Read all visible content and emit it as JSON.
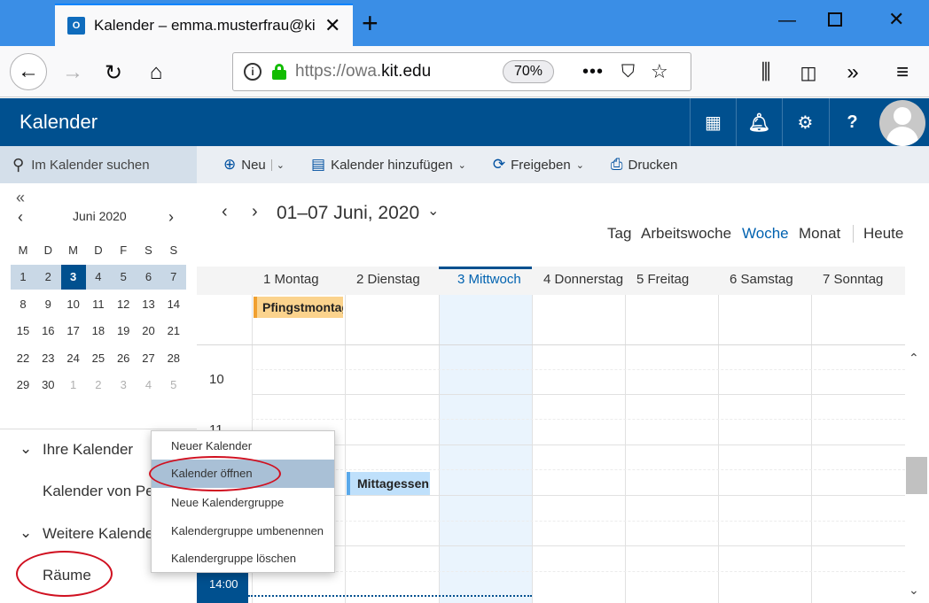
{
  "browser": {
    "tab_title": "Kalender – emma.musterfrau@kit.edu",
    "tab_favicon": "outlook-icon",
    "url_prefix": "https://owa.",
    "url_domain": "kit.edu",
    "zoom": "70%"
  },
  "app": {
    "title": "Kalender"
  },
  "search": {
    "placeholder": "Im Kalender suchen"
  },
  "toolbar": {
    "new_label": "Neu",
    "add_calendar_label": "Kalender hinzufügen",
    "share_label": "Freigeben",
    "print_label": "Drucken"
  },
  "mini_calendar": {
    "collapse": "«",
    "month_title": "Juni 2020",
    "weekday_headers": [
      "M",
      "D",
      "M",
      "D",
      "F",
      "S",
      "S"
    ],
    "weeks": [
      [
        "1",
        "2",
        "3",
        "4",
        "5",
        "6",
        "7"
      ],
      [
        "8",
        "9",
        "10",
        "11",
        "12",
        "13",
        "14"
      ],
      [
        "15",
        "16",
        "17",
        "18",
        "19",
        "20",
        "21"
      ],
      [
        "22",
        "23",
        "24",
        "25",
        "26",
        "27",
        "28"
      ],
      [
        "29",
        "30",
        "1",
        "2",
        "3",
        "4",
        "5"
      ]
    ],
    "today": "3"
  },
  "left_nav": {
    "your_calendars": "Ihre Kalender",
    "calendar_of": "Kalender von Pe",
    "other_calendars": "Weitere Kalende",
    "rooms": "Räume"
  },
  "calendar": {
    "date_range": "01–07 Juni, 2020",
    "views": [
      "Tag",
      "Arbeitswoche",
      "Woche",
      "Monat"
    ],
    "active_view": "Woche",
    "today_button": "Heute",
    "days": [
      {
        "num": "1",
        "name": "Montag"
      },
      {
        "num": "2",
        "name": "Dienstag"
      },
      {
        "num": "3",
        "name": "Mittwoch"
      },
      {
        "num": "4",
        "name": "Donnerstag"
      },
      {
        "num": "5",
        "name": "Freitag"
      },
      {
        "num": "6",
        "name": "Samstag"
      },
      {
        "num": "7",
        "name": "Sonntag"
      }
    ],
    "hours": [
      "10",
      "11",
      "14:00"
    ],
    "events": {
      "holiday": "Pfingstmontag",
      "lunch": "Mittagessen"
    }
  },
  "context_menu": {
    "items": [
      "Neuer Kalender",
      "Kalender öffnen",
      "Neue Kalendergruppe",
      "Kalendergruppe umbenennen",
      "Kalendergruppe löschen"
    ],
    "highlighted": "Kalender öffnen"
  },
  "colors": {
    "brand": "#00508f",
    "annotation": "#d01020"
  }
}
